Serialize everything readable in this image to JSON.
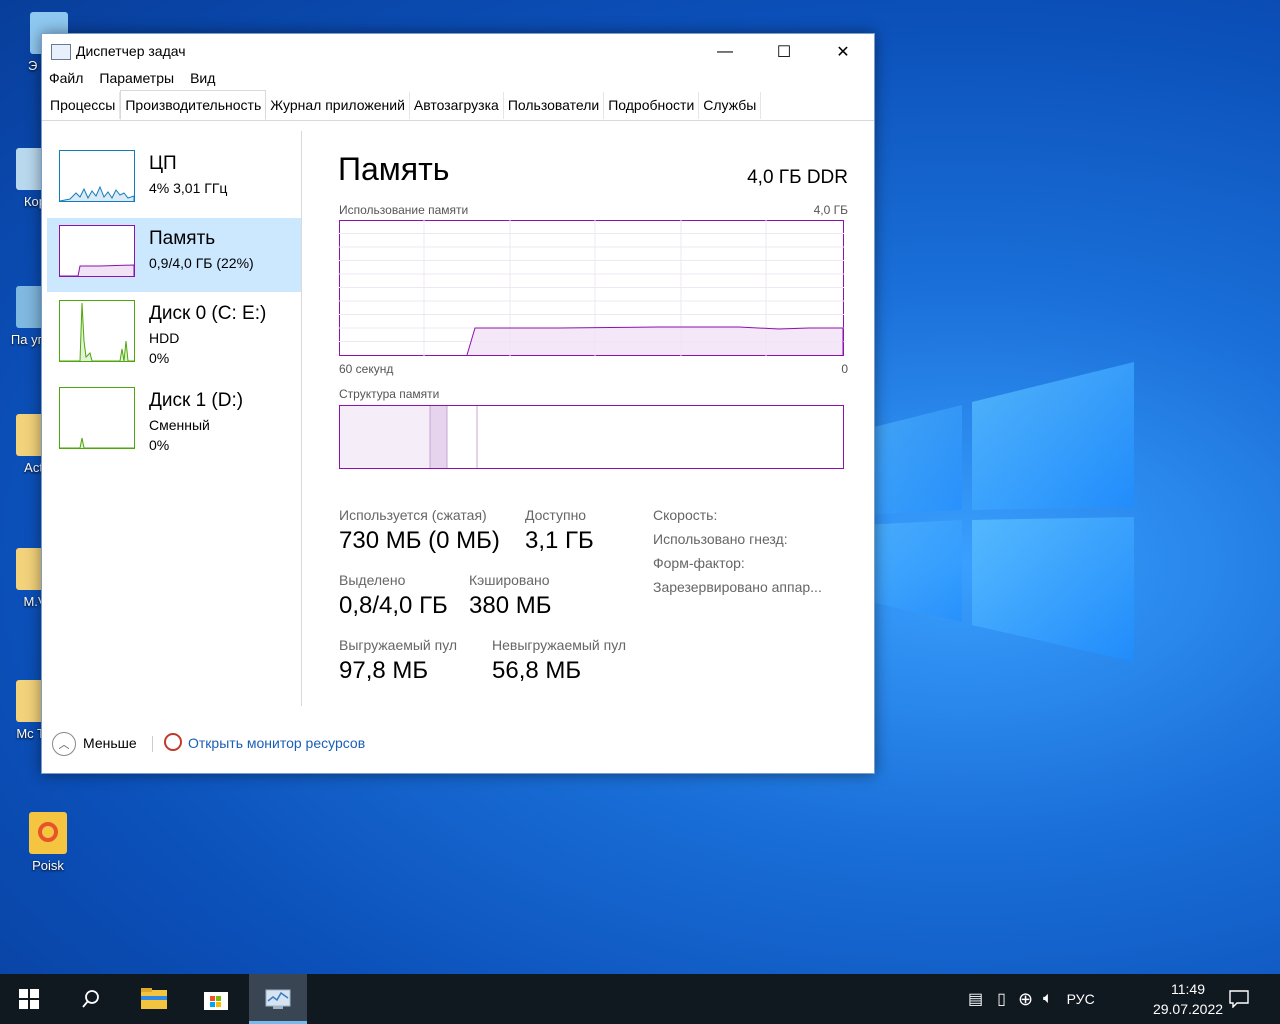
{
  "desktop": {
    "icons": [
      {
        "label": "Э комп"
      },
      {
        "label": "Кор"
      },
      {
        "label": "Па упра"
      },
      {
        "label": "Acti"
      },
      {
        "label": "M.V"
      },
      {
        "label": "Mc Tw"
      },
      {
        "label": "Poisk"
      }
    ]
  },
  "window": {
    "title": "Диспетчер задач",
    "minimize_glyph": "—",
    "maximize_glyph": "☐",
    "close_glyph": "✕"
  },
  "menu": [
    "Файл",
    "Параметры",
    "Вид"
  ],
  "tabs": [
    "Процессы",
    "Производительность",
    "Журнал приложений",
    "Автозагрузка",
    "Пользователи",
    "Подробности",
    "Службы"
  ],
  "active_tab": "Производительность",
  "sidebar": {
    "items": [
      {
        "name": "ЦП",
        "sub1": "4% 3,01 ГГц",
        "sub2": "",
        "color": "#117dbb"
      },
      {
        "name": "Память",
        "sub1": "0,9/4,0 ГБ (22%)",
        "sub2": "",
        "color": "#8b12ae"
      },
      {
        "name": "Диск 0 (C: E:)",
        "sub1": "HDD",
        "sub2": "0%",
        "color": "#4da60c"
      },
      {
        "name": "Диск 1 (D:)",
        "sub1": "Сменный",
        "sub2": "0%",
        "color": "#4da60c"
      }
    ]
  },
  "memory": {
    "title": "Память",
    "type": "4,0 ГБ DDR",
    "usage_label": "Использование памяти",
    "usage_max": "4,0 ГБ",
    "time_left": "60 секунд",
    "time_right": "0",
    "composition_label": "Структура памяти",
    "chart_color": "#8b12ae",
    "stats": {
      "in_use_label": "Используется (сжатая)",
      "in_use_value": "730 МБ (0 МБ)",
      "available_label": "Доступно",
      "available_value": "3,1 ГБ",
      "committed_label": "Выделено",
      "committed_value": "0,8/4,0 ГБ",
      "cached_label": "Кэшировано",
      "cached_value": "380 МБ",
      "paged_label": "Выгружаемый пул",
      "paged_value": "97,8 МБ",
      "nonpaged_label": "Невыгружаемый пул",
      "nonpaged_value": "56,8 МБ"
    },
    "details": [
      "Скорость:",
      "Использовано гнезд:",
      "Форм-фактор:",
      "Зарезервировано аппар..."
    ]
  },
  "footer": {
    "less_label": "Меньше",
    "monitor_link": "Открыть монитор ресурсов"
  },
  "taskbar": {
    "lang": "РУС",
    "time": "11:49",
    "date": "29.07.2022"
  }
}
